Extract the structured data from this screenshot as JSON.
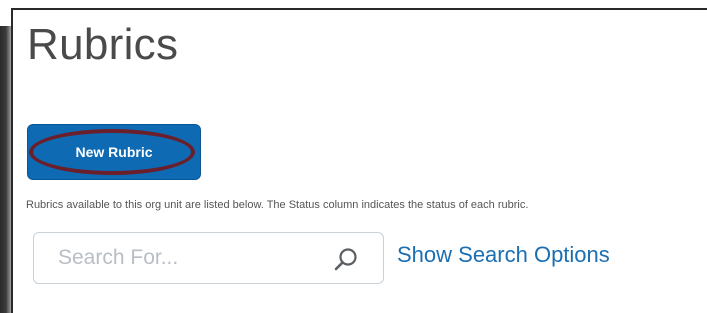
{
  "page": {
    "title": "Rubrics",
    "description": "Rubrics available to this org unit are listed below. The Status column indicates the status of each rubric."
  },
  "toolbar": {
    "new_rubric_label": "New Rubric"
  },
  "search": {
    "placeholder": "Search For...",
    "value": "",
    "show_options_label": "Show Search Options"
  },
  "colors": {
    "primary_button": "#0f6ab4",
    "highlight_oval": "#6a1f2a",
    "link": "#1a6eb2",
    "title_text": "#4a4a4a"
  },
  "icons": {
    "search": "magnifier-icon"
  }
}
